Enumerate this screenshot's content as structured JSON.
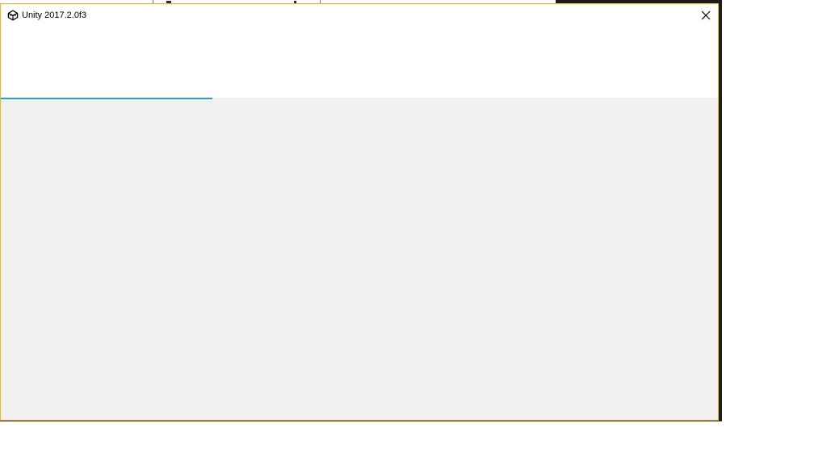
{
  "window": {
    "title": "Unity 2017.2.0f3",
    "icon": "unity-logo-icon",
    "close_icon": "close-icon",
    "border_color": "#f2b624"
  },
  "progress": {
    "fraction": 0.295,
    "color": "#16a8c8"
  }
}
